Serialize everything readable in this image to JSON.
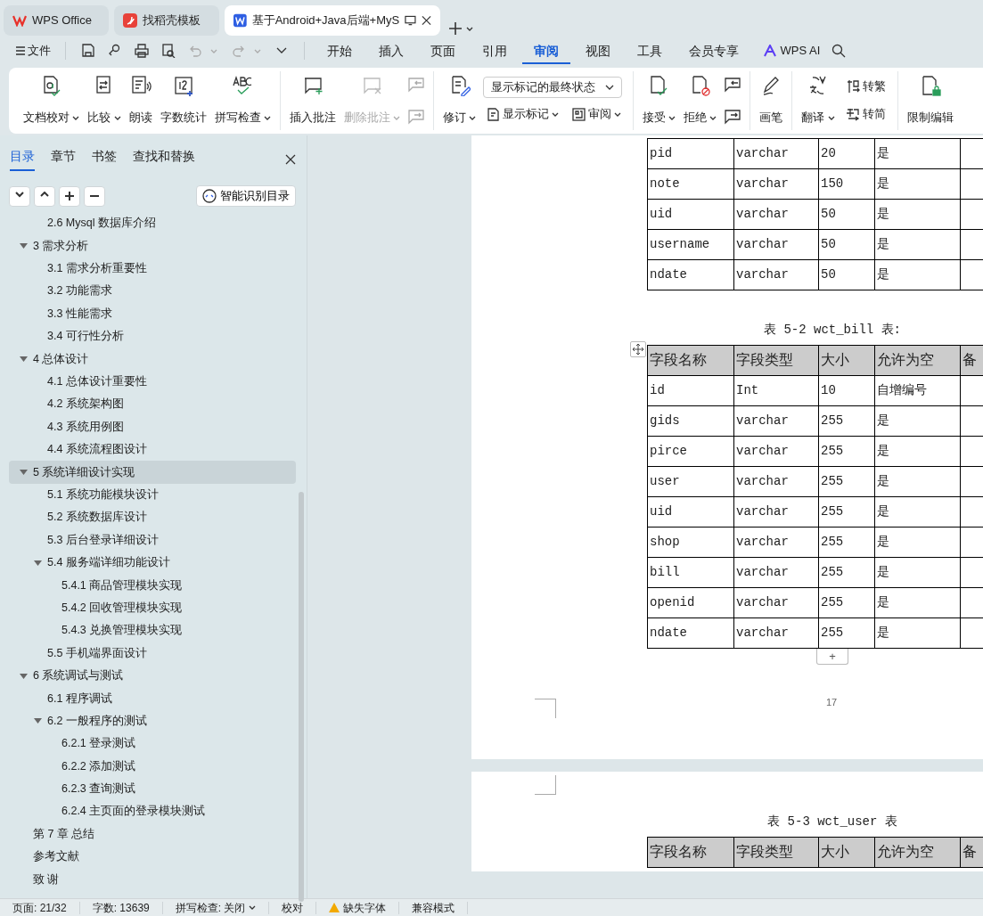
{
  "tabs": [
    {
      "label": "WPS Office",
      "kind": "wps",
      "selected": false
    },
    {
      "label": "找稻壳模板",
      "kind": "docer",
      "selected": false
    },
    {
      "label": "基于Android+Java后端+MyS",
      "kind": "writer",
      "selected": true
    }
  ],
  "menu": {
    "file": "文件",
    "tabs": [
      {
        "label": "开始",
        "selected": false
      },
      {
        "label": "插入",
        "selected": false
      },
      {
        "label": "页面",
        "selected": false
      },
      {
        "label": "引用",
        "selected": false
      },
      {
        "label": "审阅",
        "selected": true
      },
      {
        "label": "视图",
        "selected": false
      },
      {
        "label": "工具",
        "selected": false
      },
      {
        "label": "会员专享",
        "selected": false
      }
    ],
    "ai": "WPS AI"
  },
  "ribbon": [
    {
      "items": [
        {
          "kind": "big",
          "label": "文档校对",
          "dropdown": true,
          "disabled": false
        },
        {
          "kind": "big",
          "label": "比较",
          "dropdown": true,
          "disabled": false
        },
        {
          "kind": "big",
          "label": "朗读",
          "dropdown": false,
          "disabled": false
        },
        {
          "kind": "big",
          "label": "字数统计",
          "dropdown": false,
          "disabled": false
        },
        {
          "kind": "big",
          "label": "拼写检查",
          "dropdown": true,
          "disabled": false
        }
      ]
    },
    {
      "items": [
        {
          "kind": "big",
          "label": "插入批注",
          "dropdown": false,
          "disabled": false
        },
        {
          "kind": "big",
          "label": "删除批注",
          "dropdown": true,
          "disabled": true
        },
        {
          "kind": "icon_stack",
          "disabled": true
        }
      ]
    },
    {
      "items": [
        {
          "kind": "big",
          "label": "修订",
          "dropdown": true,
          "disabled": false
        },
        {
          "kind": "mark_panel",
          "select": "显示标记的最终状态",
          "buttons": [
            {
              "label": "显示标记",
              "dropdown": true
            },
            {
              "label": "审阅",
              "dropdown": true
            }
          ]
        }
      ]
    },
    {
      "items": [
        {
          "kind": "big",
          "label": "接受",
          "dropdown": true,
          "disabled": false
        },
        {
          "kind": "big",
          "label": "拒绝",
          "dropdown": true,
          "disabled": false
        },
        {
          "kind": "icon_stack",
          "disabled": false
        }
      ]
    },
    {
      "items": [
        {
          "kind": "big",
          "label": "画笔",
          "dropdown": false,
          "disabled": false
        }
      ]
    },
    {
      "items": [
        {
          "kind": "big",
          "label": "翻译",
          "dropdown": true,
          "disabled": false
        },
        {
          "kind": "small_stack",
          "buttons": [
            {
              "label": "转繁"
            },
            {
              "label": "转简"
            }
          ]
        }
      ]
    },
    {
      "items": [
        {
          "kind": "big",
          "label": "限制编辑",
          "dropdown": false,
          "disabled": false
        }
      ]
    }
  ],
  "sidebar": {
    "tabs": [
      {
        "label": "目录",
        "selected": true
      },
      {
        "label": "章节",
        "selected": false
      },
      {
        "label": "书签",
        "selected": false
      },
      {
        "label": "查找和替换",
        "selected": false
      }
    ],
    "smart_button": "智能识别目录",
    "outline": [
      {
        "children": [
          {
            "label": "2.6 Mysql 数据库介绍",
            "selected": false
          }
        ]
      },
      {
        "label": "3  需求分析",
        "expanded": true,
        "selected": false,
        "children": [
          {
            "label": "3.1  需求分析重要性",
            "selected": false
          },
          {
            "label": "3.2  功能需求",
            "selected": false
          },
          {
            "label": "3.3  性能需求",
            "selected": false
          },
          {
            "label": "3.4  可行性分析",
            "selected": false
          }
        ]
      },
      {
        "label": "4  总体设计",
        "expanded": true,
        "selected": false,
        "children": [
          {
            "label": "4.1  总体设计重要性",
            "selected": false
          },
          {
            "label": "4.2  系统架构图",
            "selected": false
          },
          {
            "label": "4.3  系统用例图",
            "selected": false
          },
          {
            "label": "4.4  系统流程图设计",
            "selected": false
          }
        ]
      },
      {
        "label": "5  系统详细设计实现",
        "expanded": true,
        "selected": true,
        "children": [
          {
            "label": "5.1  系统功能模块设计",
            "selected": false
          },
          {
            "label": "5.2  系统数据库设计",
            "selected": false
          },
          {
            "label": "5.3  后台登录详细设计",
            "selected": false
          },
          {
            "label": "5.4  服务端详细功能设计",
            "expanded": true,
            "selected": false,
            "children": [
              {
                "label": "5.4.1  商品管理模块实现",
                "selected": false
              },
              {
                "label": "5.4.2  回收管理模块实现",
                "selected": false
              },
              {
                "label": "5.4.3  兑换管理模块实现",
                "selected": false
              }
            ]
          },
          {
            "label": "5.5  手机端界面设计",
            "selected": false
          }
        ]
      },
      {
        "label": "6  系统调试与测试",
        "expanded": true,
        "selected": false,
        "children": [
          {
            "label": "6.1  程序调试",
            "selected": false
          },
          {
            "label": "6.2  一般程序的测试",
            "expanded": true,
            "selected": false,
            "children": [
              {
                "label": "6.2.1  登录测试",
                "selected": false
              },
              {
                "label": "6.2.2  添加测试",
                "selected": false
              },
              {
                "label": "6.2.3  查询测试",
                "selected": false
              },
              {
                "label": "6.2.4  主页面的登录模块测试",
                "selected": false
              }
            ]
          }
        ]
      },
      {
        "label": "第 7 章  总结",
        "selected": false
      },
      {
        "label": "参考文献",
        "selected": false
      },
      {
        "label": "致 谢",
        "selected": false
      }
    ]
  },
  "document": {
    "pages": [
      {
        "blocks": [
          {
            "kind": "table",
            "rows": [
              [
                "pid",
                "varchar",
                "20",
                "是"
              ],
              [
                "note",
                "varchar",
                "150",
                "是"
              ],
              [
                "uid",
                "varchar",
                "50",
                "是"
              ],
              [
                "username",
                "varchar",
                "50",
                "是"
              ],
              [
                "ndate",
                "varchar",
                "50",
                "是"
              ]
            ]
          },
          {
            "kind": "caption",
            "text": "表 5-2 wct_bill 表:"
          },
          {
            "kind": "table",
            "handle": true,
            "columns": [
              "字段名称",
              "字段类型",
              "大小",
              "允许为空",
              "备"
            ],
            "rows": [
              [
                "id",
                "Int",
                "10",
                "自增编号"
              ],
              [
                "gids",
                "varchar",
                "255",
                "是"
              ],
              [
                "pirce",
                "varchar",
                "255",
                "是"
              ],
              [
                "user",
                "varchar",
                "255",
                "是"
              ],
              [
                "uid",
                "varchar",
                "255",
                "是"
              ],
              [
                "shop",
                "varchar",
                "255",
                "是"
              ],
              [
                "bill",
                "varchar",
                "255",
                "是"
              ],
              [
                "openid",
                "varchar",
                "255",
                "是"
              ],
              [
                "ndate",
                "varchar",
                "255",
                "是"
              ]
            ],
            "add_row": "+"
          }
        ],
        "page_number": "17"
      },
      {
        "blocks": [
          {
            "kind": "caption",
            "text": "表 5-3 wct_user 表"
          },
          {
            "kind": "table",
            "columns": [
              "字段名称",
              "字段类型",
              "大小",
              "允许为空",
              "备"
            ]
          }
        ]
      }
    ]
  },
  "status_bar": [
    {
      "label": "页面: 21/32",
      "dropdown": false,
      "warning": false
    },
    {
      "label": "字数: 13639",
      "dropdown": false,
      "warning": false
    },
    {
      "label": "拼写检查: 关闭",
      "dropdown": true,
      "warning": false
    },
    {
      "label": "校对",
      "dropdown": false,
      "warning": false
    },
    {
      "label": "缺失字体",
      "dropdown": false,
      "warning": true
    },
    {
      "label": "兼容模式",
      "dropdown": false,
      "warning": false
    }
  ]
}
